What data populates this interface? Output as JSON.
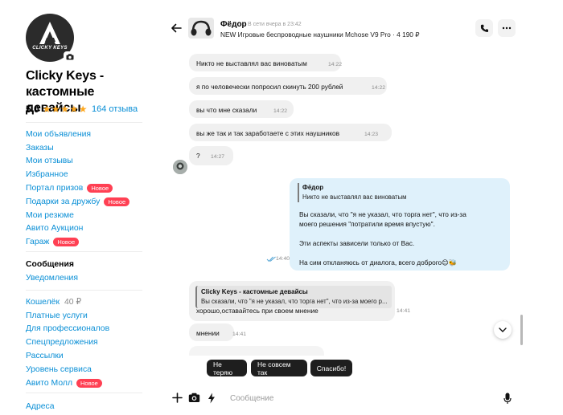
{
  "profile": {
    "brand_text": "CLICKY KEYS",
    "name": "Clicky Keys - кастомные девайсы",
    "rating": "5,0",
    "stars": "★★★★★",
    "reviews": "164 отзыва"
  },
  "menu1": [
    {
      "label": "Мои объявления"
    },
    {
      "label": "Заказы"
    },
    {
      "label": "Мои отзывы"
    },
    {
      "label": "Избранное"
    },
    {
      "label": "Портал призов",
      "badge": "Новое"
    },
    {
      "label": "Подарки за дружбу",
      "badge": "Новое"
    },
    {
      "label": "Мои резюме"
    },
    {
      "label": "Авито Аукцион"
    },
    {
      "label": "Гараж",
      "badge": "Новое"
    }
  ],
  "menu2": [
    {
      "label": "Сообщения"
    },
    {
      "label": "Уведомления"
    }
  ],
  "menu3": [
    {
      "label": "Кошелёк",
      "amount": "40 ₽"
    },
    {
      "label": "Платные услуги"
    },
    {
      "label": "Для профессионалов"
    },
    {
      "label": "Спецпредложения"
    },
    {
      "label": "Рассылки"
    },
    {
      "label": "Уровень сервиса"
    },
    {
      "label": "Авито Молл",
      "badge": "Новое"
    }
  ],
  "menu4": [
    {
      "label": "Адреса"
    }
  ],
  "chat": {
    "contact_name": "Фёдор",
    "contact_status": "В сети вчера в 23:42",
    "item_title": "NEW Игровые беспроводные наушники Mchose V9 Pro · 4 190 ₽",
    "messages": [
      {
        "text": "Никто не выставлял вас виноватым",
        "time": "14:22"
      },
      {
        "text": "я по человечески попросил скинуть 200 рублей",
        "time": "14:22"
      },
      {
        "text": "вы что мне сказали",
        "time": "14:22"
      },
      {
        "text": "вы же так и так заработаете с этих наушников",
        "time": "14:23"
      },
      {
        "text": "?",
        "time": "14:27"
      }
    ],
    "outgoing": {
      "quote_name": "Фёдор",
      "quote_text": "Никто не выставлял вас виноватым",
      "line1": "Вы сказали, что \"я не указал, что торга нет\", что из-за",
      "line2": "моего решения \"потратили время впустую\".",
      "line3": "Эти аспекты зависели только от Вас.",
      "line4": "На сим откланяюсь от диалога, всего доброго😊🐝",
      "time": "14:40"
    },
    "reply": {
      "quote_name": "Clicky Keys - кастомные девайсы",
      "quote_text": "Вы сказали, что \"я не указал, что торга нет\", что из-за моего р...",
      "text": "хорошо,оставайтесь при своем мнение",
      "time": "14:41"
    },
    "last": {
      "text": "мнении",
      "time": "14:41"
    },
    "quick_replies": [
      "Не теряю",
      "Не совсем так",
      "Спасибо!"
    ],
    "compose_placeholder": "Сообщение"
  }
}
